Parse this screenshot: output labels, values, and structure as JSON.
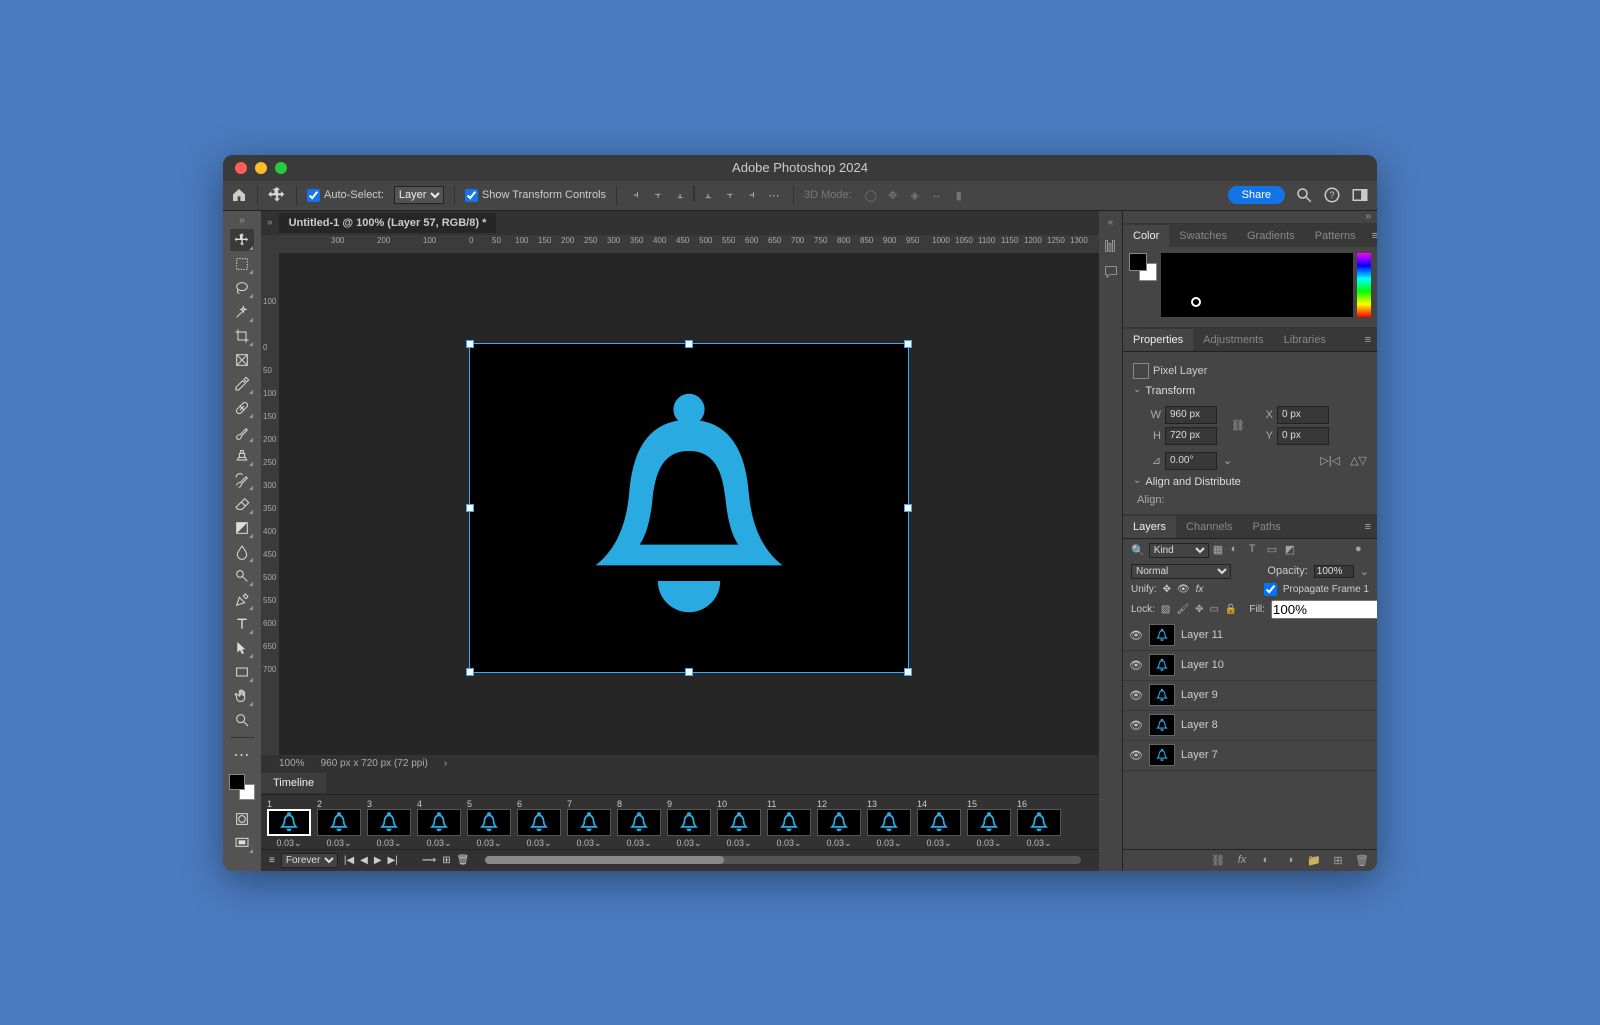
{
  "window": {
    "title": "Adobe Photoshop 2024"
  },
  "options": {
    "auto_select_label": "Auto-Select:",
    "auto_select_target": "Layer",
    "transform_controls_label": "Show Transform Controls",
    "mode3d_label": "3D Mode:",
    "share_label": "Share"
  },
  "document": {
    "tab_label": "Untitled-1 @ 100% (Layer 57, RGB/8) *",
    "zoom": "100%",
    "info": "960 px x 720 px (72 ppi)"
  },
  "ruler": {
    "h": [
      "0",
      "50",
      "100",
      "150",
      "200",
      "250",
      "300",
      "350",
      "400",
      "450",
      "500",
      "550",
      "600",
      "650",
      "700",
      "750",
      "800",
      "850",
      "900",
      "950"
    ],
    "h_left": [
      "300",
      "200",
      "100"
    ],
    "h_right": [
      "1000",
      "1050",
      "1100",
      "1150",
      "1200",
      "1250",
      "1300"
    ],
    "v": [
      "0",
      "50",
      "100",
      "150",
      "200",
      "250",
      "300",
      "350",
      "400",
      "450",
      "500",
      "550",
      "600",
      "650",
      "700"
    ],
    "v_top": [
      "100"
    ]
  },
  "timeline": {
    "title": "Timeline",
    "frames": [
      {
        "n": "1",
        "d": "0.03"
      },
      {
        "n": "2",
        "d": "0.03"
      },
      {
        "n": "3",
        "d": "0.03"
      },
      {
        "n": "4",
        "d": "0.03"
      },
      {
        "n": "5",
        "d": "0.03"
      },
      {
        "n": "6",
        "d": "0.03"
      },
      {
        "n": "7",
        "d": "0.03"
      },
      {
        "n": "8",
        "d": "0.03"
      },
      {
        "n": "9",
        "d": "0.03"
      },
      {
        "n": "10",
        "d": "0.03"
      },
      {
        "n": "11",
        "d": "0.03"
      },
      {
        "n": "12",
        "d": "0.03"
      },
      {
        "n": "13",
        "d": "0.03"
      },
      {
        "n": "14",
        "d": "0.03"
      },
      {
        "n": "15",
        "d": "0.03"
      },
      {
        "n": "16",
        "d": "0.03"
      }
    ],
    "loop": "Forever"
  },
  "panels": {
    "color_tabs": [
      "Color",
      "Swatches",
      "Gradients",
      "Patterns"
    ],
    "props_tabs": [
      "Properties",
      "Adjustments",
      "Libraries"
    ],
    "layers_tabs": [
      "Layers",
      "Channels",
      "Paths"
    ]
  },
  "properties": {
    "type_label": "Pixel Layer",
    "transform_header": "Transform",
    "w_label": "W",
    "w_val": "960 px",
    "h_label": "H",
    "h_val": "720 px",
    "x_label": "X",
    "x_val": "0 px",
    "y_label": "Y",
    "y_val": "0 px",
    "angle_val": "0.00°",
    "align_header": "Align and Distribute",
    "align_label": "Align:"
  },
  "layers": {
    "filter_kind": "Kind",
    "blend_mode": "Normal",
    "opacity_label": "Opacity:",
    "opacity_val": "100%",
    "unify_label": "Unify:",
    "propagate_label": "Propagate Frame 1",
    "lock_label": "Lock:",
    "fill_label": "Fill:",
    "fill_val": "100%",
    "items": [
      {
        "name": "Layer 11"
      },
      {
        "name": "Layer 10"
      },
      {
        "name": "Layer 9"
      },
      {
        "name": "Layer 8"
      },
      {
        "name": "Layer 7"
      }
    ]
  }
}
